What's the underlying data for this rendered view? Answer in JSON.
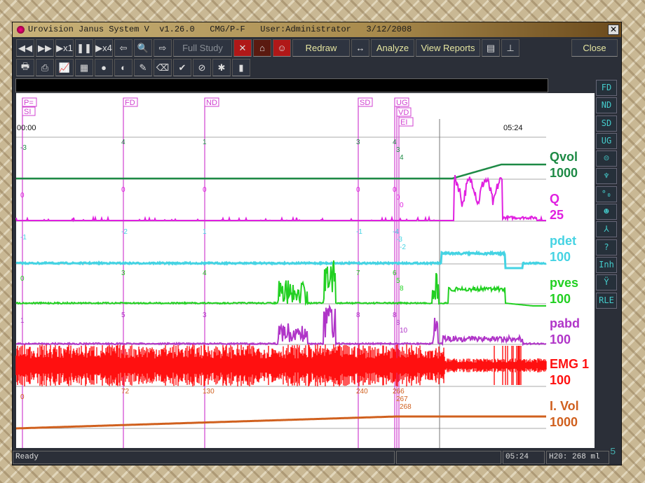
{
  "window": {
    "title": "Urovision Janus System V  v1.26.0   CMG/P-F   User:Administrator   3/12/2008",
    "close_icon": "close-x"
  },
  "toolbar1": [
    {
      "n": "rewind",
      "t": "◀◀"
    },
    {
      "n": "fast-forward",
      "t": "▶▶"
    },
    {
      "n": "play-x1",
      "t": "▶x1"
    },
    {
      "n": "pause",
      "t": "❚❚"
    },
    {
      "n": "play-x4",
      "t": "▶x4"
    },
    {
      "n": "back-arrow",
      "t": "⇦"
    },
    {
      "n": "zoom",
      "t": "🔍"
    },
    {
      "n": "forward-arrow",
      "t": "⇨"
    }
  ],
  "full_study": "Full Study",
  "toolbar1b": [
    {
      "n": "event-marker",
      "t": "✕"
    },
    {
      "n": "mark",
      "t": "⌂"
    },
    {
      "n": "face",
      "t": "☺"
    }
  ],
  "redraw": "Redraw",
  "resize_icon": "↔",
  "analyze": "Analyze",
  "view_reports": "View Reports",
  "toolbar1c": [
    {
      "n": "layout",
      "t": "▤"
    },
    {
      "n": "axis",
      "t": "⊥"
    }
  ],
  "close": "Close",
  "toolbar2": [
    "printer",
    "print-setup",
    "graph",
    "grid",
    "color",
    "contrast",
    "pen",
    "eraser",
    "check",
    "no-entry",
    "palette",
    "bar-chart"
  ],
  "toolbar2_glyphs": [
    "🖶",
    "⎙",
    "📈",
    "▦",
    "●",
    "◐",
    "✎",
    "⌫",
    "✔",
    "⊘",
    "✱",
    "▮"
  ],
  "plot": {
    "start_time": "00:00",
    "cursor_time": "05:24",
    "events": [
      {
        "label": "P=",
        "label2": "SI",
        "t": 0
      },
      {
        "label": "FD",
        "t": 72
      },
      {
        "label": "ND",
        "t": 130
      },
      {
        "label": "SD",
        "t": 240
      },
      {
        "label": "UG",
        "t": 266
      },
      {
        "label": "VD",
        "t": 267
      },
      {
        "label": "EI",
        "t": 268
      }
    ],
    "channels": [
      {
        "name": "Qvol",
        "scale": "1000",
        "color": "#1d8a45",
        "event_values": [
          "-3",
          "4",
          "1",
          "3",
          "4",
          "3",
          "4"
        ]
      },
      {
        "name": "Q",
        "scale": "25",
        "color": "#e020e0",
        "event_values": [
          "0",
          "0",
          "0",
          "0",
          "0",
          "0",
          "0"
        ]
      },
      {
        "name": "pdet",
        "scale": "100",
        "color": "#45d3e3",
        "event_values": [
          "-1",
          "-2",
          "1",
          "-1",
          "-4",
          "-3",
          "-2"
        ]
      },
      {
        "name": "pves",
        "scale": "100",
        "color": "#22d022",
        "event_values": [
          "0",
          "3",
          "4",
          "7",
          "6",
          "5",
          "8"
        ]
      },
      {
        "name": "pabd",
        "scale": "100",
        "color": "#b035c8",
        "event_values": [
          "1",
          "5",
          "3",
          "8",
          "8",
          "8",
          "10"
        ]
      },
      {
        "name": "EMG 1",
        "scale": "100",
        "color": "#ff1010",
        "event_values": []
      },
      {
        "name": "I. Vol",
        "scale": "1000",
        "color": "#d0601e",
        "event_values": [
          "0",
          "72",
          "130",
          "240",
          "266",
          "267",
          "268"
        ]
      }
    ]
  },
  "side_buttons": [
    "FD",
    "ND",
    "SD",
    "UG",
    "☹",
    "♆",
    "°₀",
    "☻",
    "⅄",
    "?",
    "Inh",
    "Ÿ",
    "RLE"
  ],
  "side_names": [
    "fd",
    "nd",
    "sd",
    "ug",
    "face",
    "funnel",
    "drops",
    "mask",
    "peak",
    "help",
    "inh",
    "valve",
    "rle"
  ],
  "status": {
    "text": "Ready",
    "time": "05:24",
    "volume": "H20: 268 ml",
    "page": "5"
  }
}
